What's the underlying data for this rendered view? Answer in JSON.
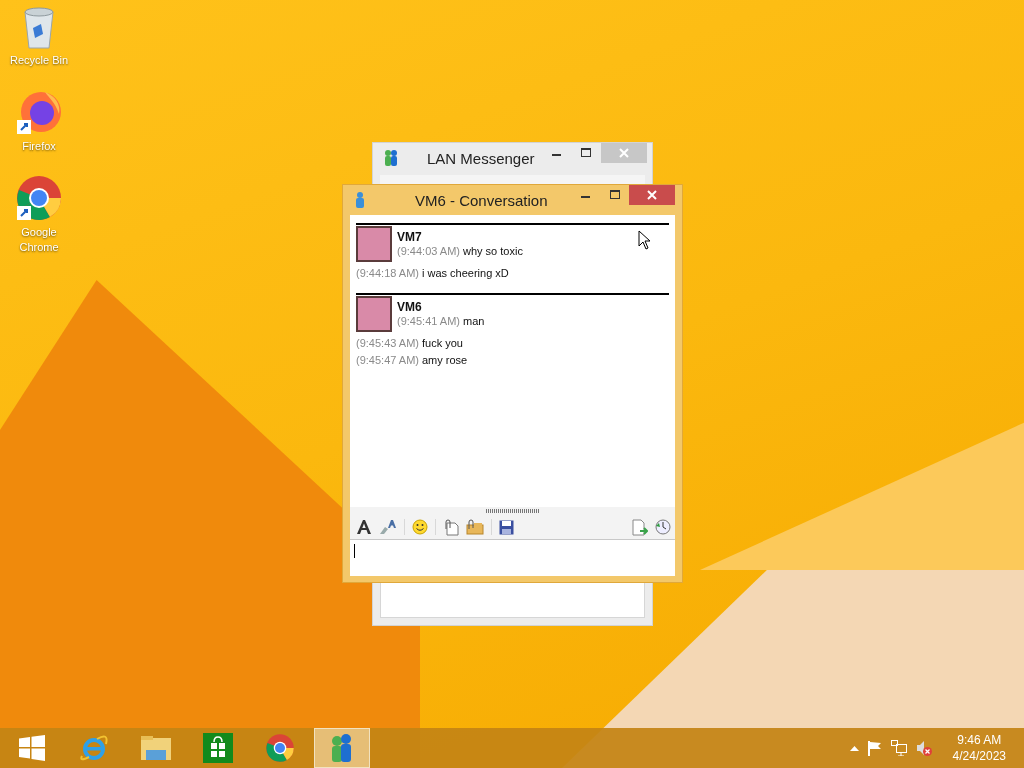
{
  "desktop_icons": [
    {
      "kind": "recycle",
      "label": "Recycle Bin"
    },
    {
      "kind": "firefox",
      "label": "Firefox"
    },
    {
      "kind": "chrome",
      "label": "Google Chrome"
    }
  ],
  "messenger_window": {
    "title": "LAN Messenger"
  },
  "conversation_window": {
    "title": "VM6 - Conversation",
    "messages": [
      {
        "sender": "VM7",
        "entries": [
          {
            "time": "(9:44:03 AM)",
            "text": "why so toxic"
          },
          {
            "time": "(9:44:18 AM)",
            "text": "i was cheering xD"
          }
        ]
      },
      {
        "sender": "VM6",
        "entries": [
          {
            "time": "(9:45:41 AM)",
            "text": "man"
          },
          {
            "time": "(9:45:43 AM)",
            "text": "fuck you"
          },
          {
            "time": "(9:45:47 AM)",
            "text": "amy rose"
          }
        ]
      }
    ]
  },
  "taskbar": {
    "items": [
      {
        "kind": "start",
        "selected": false
      },
      {
        "kind": "ie",
        "selected": false
      },
      {
        "kind": "explorer",
        "selected": false
      },
      {
        "kind": "store",
        "selected": false
      },
      {
        "kind": "chrome",
        "selected": false
      },
      {
        "kind": "messenger",
        "selected": true
      }
    ],
    "clock": {
      "time": "9:46 AM",
      "date": "4/24/2023"
    }
  }
}
